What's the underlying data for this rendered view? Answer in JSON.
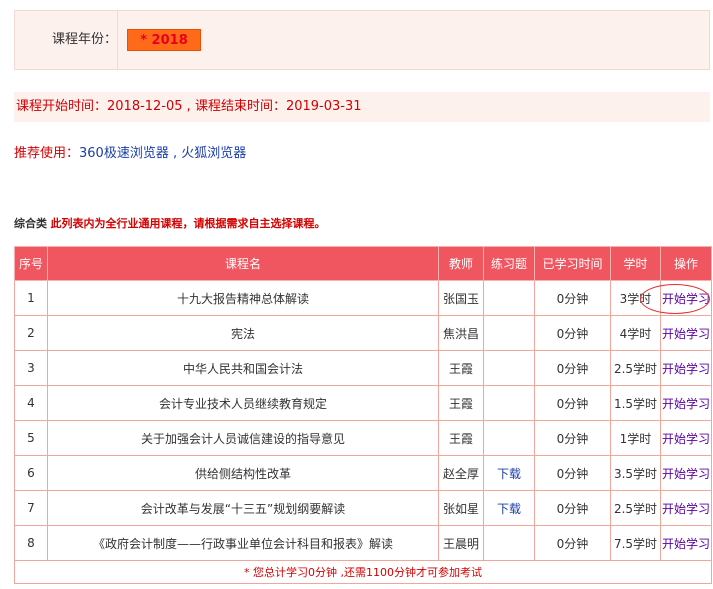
{
  "year": {
    "label": "课程年份：",
    "selected": "* 2018"
  },
  "dates": {
    "text": "课程开始时间：2018-12-05 , 课程结束时间：2019-03-31"
  },
  "browser": {
    "label": "推荐使用：",
    "value": "360极速浏览器 , 火狐浏览器"
  },
  "notice": {
    "category": "综合类",
    "message": "此列表内为全行业通用课程，请根据需求自主选择课程。"
  },
  "table": {
    "headers": {
      "no": "序号",
      "name": "课程名",
      "teacher": "教师",
      "exercise": "练习题",
      "studied": "已学习时间",
      "hours": "学时",
      "action": "操作"
    },
    "rows": [
      {
        "no": "1",
        "name": "十九大报告精神总体解读",
        "teacher": "张国玉",
        "exercise": "",
        "studied": "0分钟",
        "hours": "3学时",
        "action": "开始学习"
      },
      {
        "no": "2",
        "name": "宪法",
        "teacher": "焦洪昌",
        "exercise": "",
        "studied": "0分钟",
        "hours": "4学时",
        "action": "开始学习"
      },
      {
        "no": "3",
        "name": "中华人民共和国会计法",
        "teacher": "王霞",
        "exercise": "",
        "studied": "0分钟",
        "hours": "2.5学时",
        "action": "开始学习"
      },
      {
        "no": "4",
        "name": "会计专业技术人员继续教育规定",
        "teacher": "王霞",
        "exercise": "",
        "studied": "0分钟",
        "hours": "1.5学时",
        "action": "开始学习"
      },
      {
        "no": "5",
        "name": "关于加强会计人员诚信建设的指导意见",
        "teacher": "王霞",
        "exercise": "",
        "studied": "0分钟",
        "hours": "1学时",
        "action": "开始学习"
      },
      {
        "no": "6",
        "name": "供给侧结构性改革",
        "teacher": "赵全厚",
        "exercise": "下载",
        "studied": "0分钟",
        "hours": "3.5学时",
        "action": "开始学习"
      },
      {
        "no": "7",
        "name": "会计改革与发展“十三五”规划纲要解读",
        "teacher": "张如星",
        "exercise": "下载",
        "studied": "0分钟",
        "hours": "2.5学时",
        "action": "开始学习"
      },
      {
        "no": "8",
        "name": "《政府会计制度——行政事业单位会计科目和报表》解读",
        "teacher": "王晨明",
        "exercise": "",
        "studied": "0分钟",
        "hours": "7.5学时",
        "action": "开始学习"
      }
    ],
    "footer": "* 您总计学习0分钟 ,还需1100分钟才可参加考试"
  }
}
